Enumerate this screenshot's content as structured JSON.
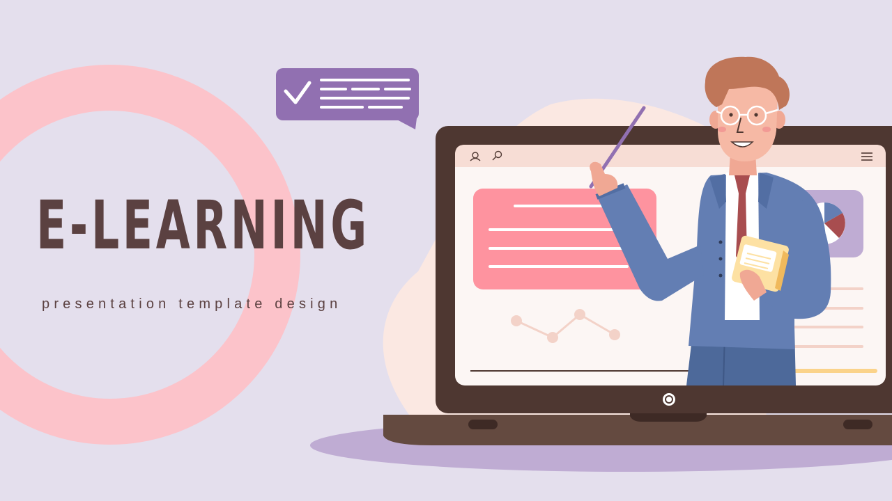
{
  "slide": {
    "title": "E-LEARNING",
    "subtitle": "presentation template design"
  },
  "colors": {
    "background": "#e4dfed",
    "ring": "#fcc3ca",
    "title_text": "#5b4141",
    "speech_bubble": "#9170b1",
    "laptop_frame": "#4e3731",
    "laptop_base": "#644a40",
    "shadow": "#bfacd3",
    "blob": "#fbe8e2",
    "screen": "#fcf6f4",
    "screen_header": "#f7ddd5",
    "pink_card": "#fe939f",
    "jacket": "#637eb3"
  },
  "icons": {
    "user": "user-icon",
    "search": "search-icon",
    "menu": "hamburger-menu-icon",
    "check": "checkmark-icon",
    "camera": "webcam-icon"
  }
}
